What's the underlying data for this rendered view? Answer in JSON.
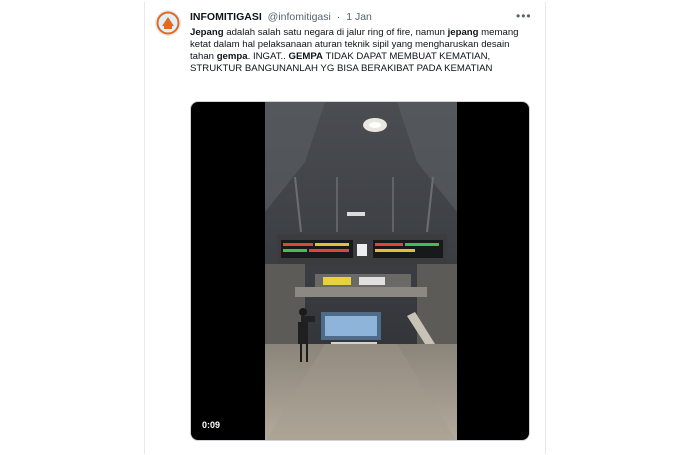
{
  "tweet": {
    "author_name": "INFOMITIGASI",
    "handle": "@infomitigasi",
    "separator": "·",
    "date": "1 Jan",
    "more_icon": "more-horizontal-icon",
    "text_parts": [
      {
        "t": "Jepang",
        "bold": true
      },
      {
        "t": " adalah salah satu negara di jalur ring of fire, namun ",
        "bold": false
      },
      {
        "t": "jepang",
        "bold": true
      },
      {
        "t": " memang ketat dalam hal pelaksanaan aturan teknik sipil yang mengharuskan desain tahan ",
        "bold": false
      },
      {
        "t": "gempa",
        "bold": true
      },
      {
        "t": ".  INGAT.. ",
        "bold": false
      },
      {
        "t": "GEMPA",
        "bold": true
      },
      {
        "t": " TIDAK DAPAT MEMBUAT KEMATIAN, STRUKTUR BANGUNANLAH YG BISA BERAKIBAT PADA KEMATIAN",
        "bold": false
      }
    ],
    "video": {
      "duration": "0:09"
    }
  },
  "colors": {
    "text": "#0f1419",
    "secondary": "#536471",
    "avatar_orange": "#e8671e"
  }
}
